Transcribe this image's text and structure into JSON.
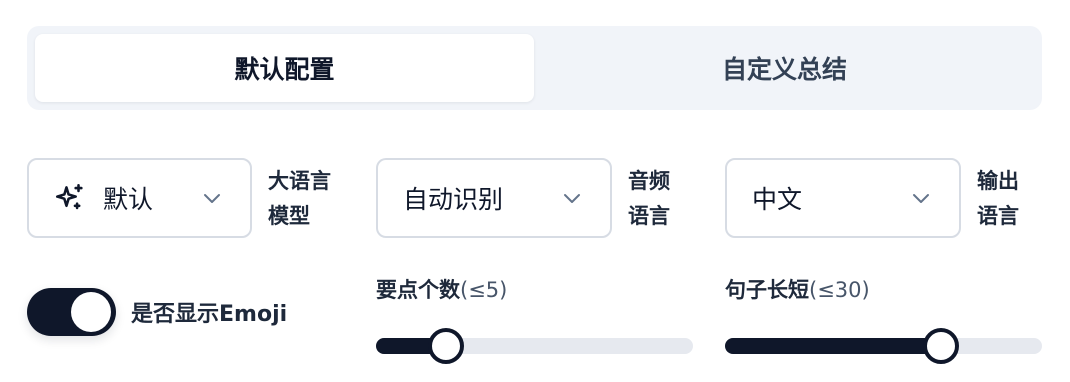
{
  "tabs": {
    "default_label": "默认配置",
    "custom_label": "自定义总结",
    "active": "default"
  },
  "llm": {
    "value": "默认",
    "label_line1": "大语言",
    "label_line2": "模型",
    "icon": "sparkles-icon"
  },
  "audio_language": {
    "value": "自动识别",
    "label_line1": "音频",
    "label_line2": "语言"
  },
  "output_language": {
    "value": "中文",
    "label_line1": "输出",
    "label_line2": "语言"
  },
  "emoji_toggle": {
    "label": "是否显示Emoji",
    "on": true
  },
  "key_points": {
    "label": "要点个数",
    "hint": "(≤5)",
    "value": 1,
    "max": 5,
    "fill_fraction": 0.22
  },
  "sentence_length": {
    "label": "句子长短",
    "hint": "(≤30)",
    "value": 20,
    "max": 30,
    "fill_fraction": 0.68
  },
  "colors": {
    "accent": "#0f172a",
    "track": "#e6e9ef",
    "tabs_bg": "#f1f4f9"
  }
}
